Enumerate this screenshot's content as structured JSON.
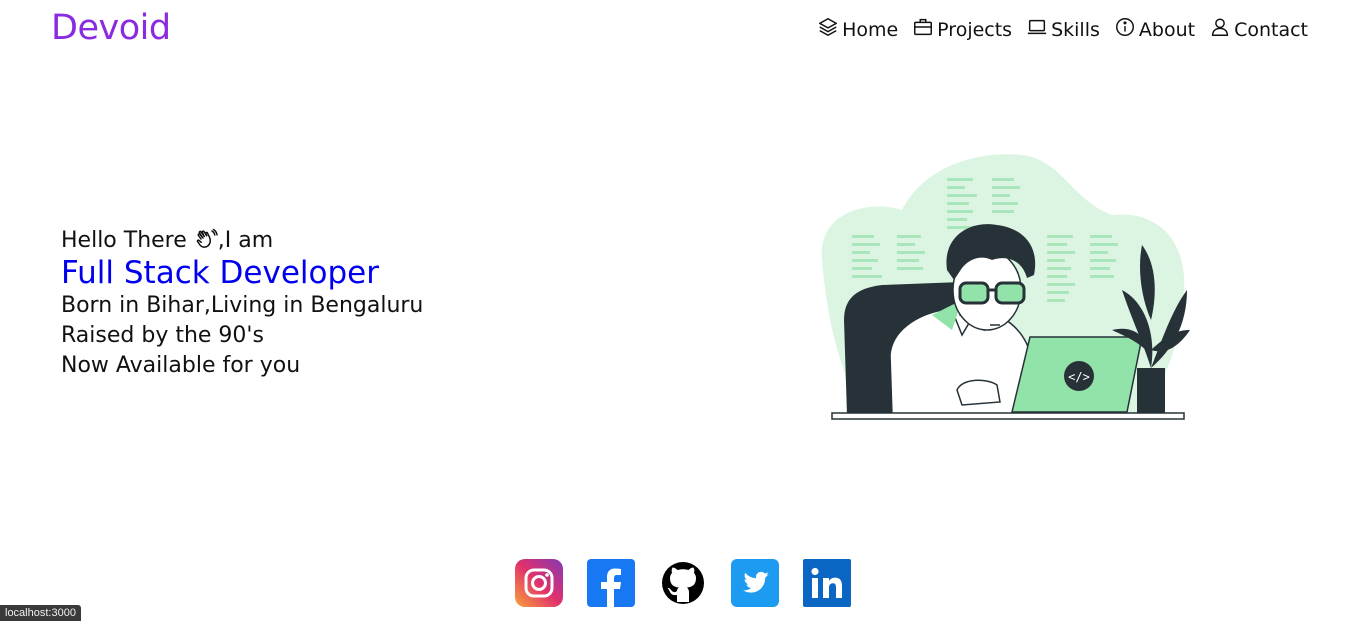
{
  "header": {
    "brand": "Devoid",
    "nav": [
      {
        "label": "Home",
        "icon": "stack-icon"
      },
      {
        "label": "Projects",
        "icon": "briefcase-icon"
      },
      {
        "label": "Skills",
        "icon": "laptop-icon"
      },
      {
        "label": "About",
        "icon": "info-icon"
      },
      {
        "label": "Contact",
        "icon": "person-icon"
      }
    ]
  },
  "hero": {
    "greeting_before": "Hello There ",
    "greeting_after": ",I am",
    "role": "Full Stack Developer",
    "line1": "Born in Bihar,Living in Bengaluru",
    "line2": "Raised by the 90's",
    "line3": "Now Available for you",
    "laptop_code": "</>"
  },
  "social": [
    {
      "name": "instagram-icon",
      "color": "#d6249f"
    },
    {
      "name": "facebook-icon",
      "color": "#1877f2"
    },
    {
      "name": "github-icon",
      "color": "#000000"
    },
    {
      "name": "twitter-icon",
      "color": "#1d9bf0"
    },
    {
      "name": "linkedin-icon",
      "color": "#0a66c2"
    }
  ],
  "statusbar": {
    "url": "localhost:3000"
  },
  "colors": {
    "brand": "#8a2be2",
    "role": "#0000ee",
    "illustration_accent": "#92e3a9"
  }
}
